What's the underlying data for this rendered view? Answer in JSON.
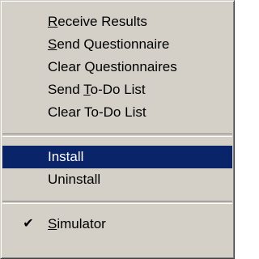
{
  "menu": {
    "items": [
      {
        "pre": "",
        "key": "R",
        "post": "eceive Results"
      },
      {
        "pre": "",
        "key": "S",
        "post": "end Questionnaire"
      },
      {
        "pre": "Clear Questionnaires",
        "key": "",
        "post": ""
      },
      {
        "pre": "Send ",
        "key": "T",
        "post": "o-Do List"
      },
      {
        "pre": "Clear To-Do List",
        "key": "",
        "post": ""
      },
      {
        "pre": "Install",
        "key": "",
        "post": ""
      },
      {
        "pre": "Uninstall",
        "key": "",
        "post": ""
      },
      {
        "pre": "",
        "key": "S",
        "post": "imulator"
      }
    ],
    "selected_item": "Install",
    "checked_item": "Simulator",
    "check_glyph": "✔",
    "highlight_color": "#0a246a",
    "menu_background": "#d4d0c8"
  }
}
